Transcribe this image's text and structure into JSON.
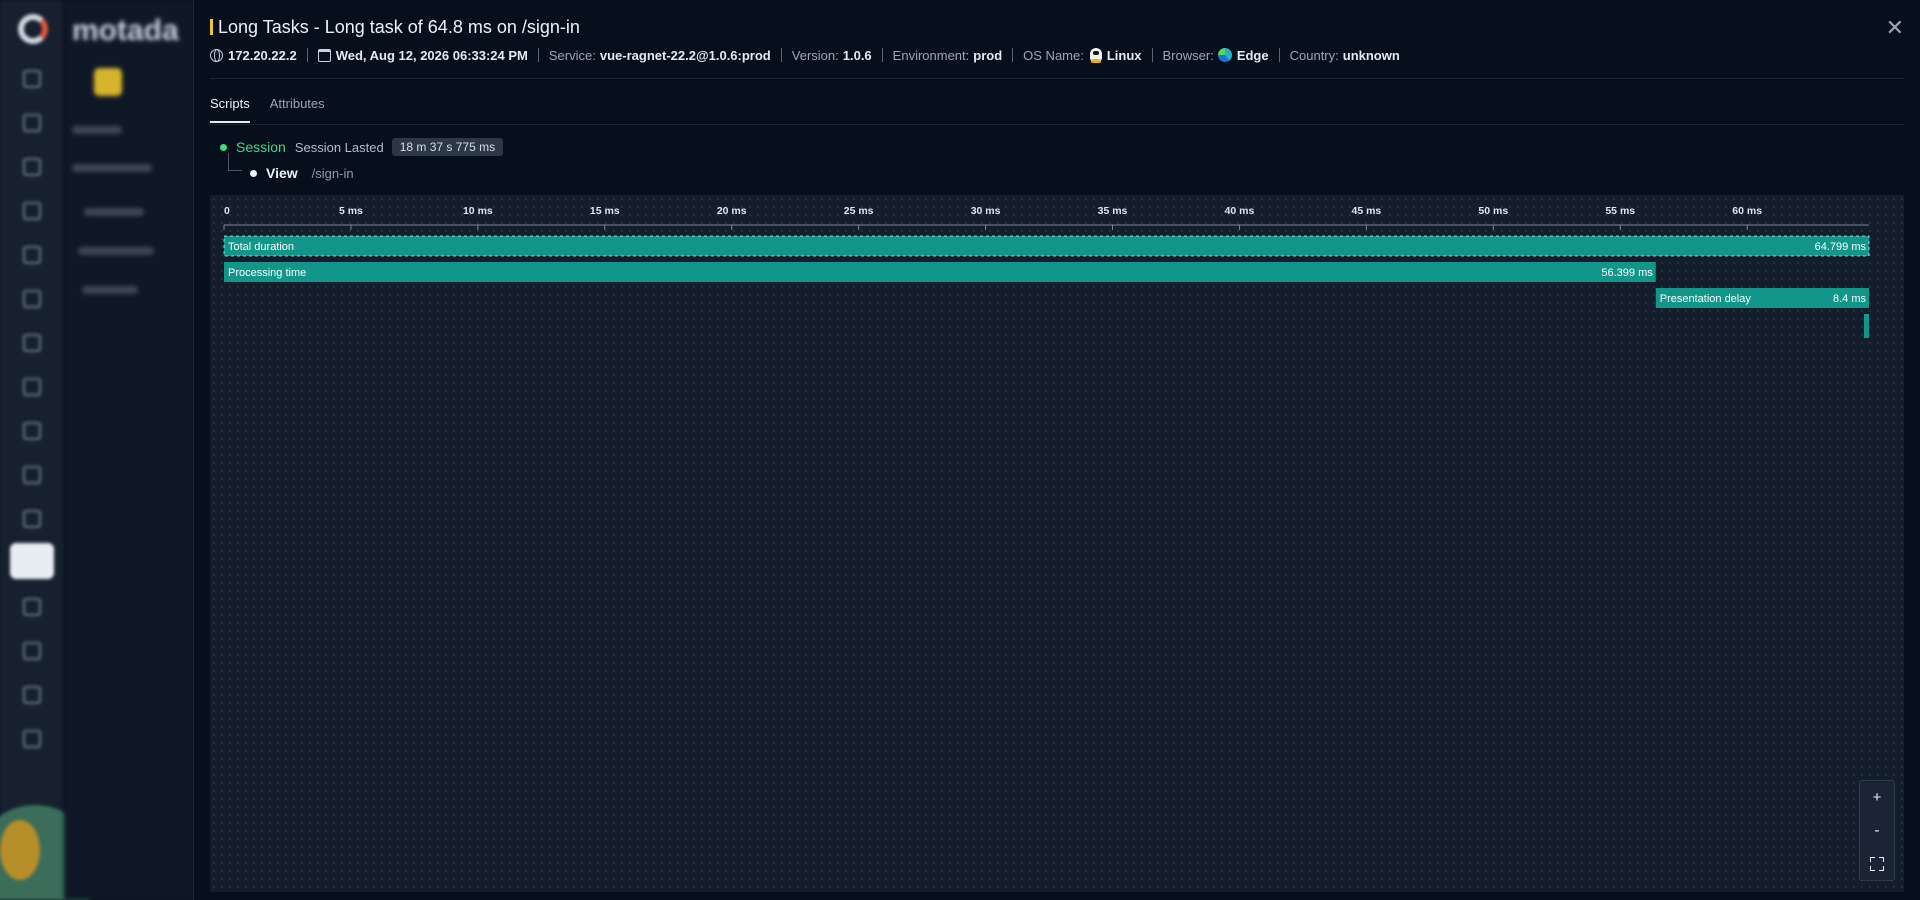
{
  "app": {
    "brand": "motada"
  },
  "header": {
    "title": "Long Tasks - Long task of 64.8 ms on /sign-in",
    "close_glyph": "✕",
    "meta": {
      "ip": "172.20.22.2",
      "datetime": "Wed, Aug 12, 2026 06:33:24 PM",
      "service_key": "Service:",
      "service_value": "vue-ragnet-22.2@1.0.6:prod",
      "version_key": "Version:",
      "version_value": "1.0.6",
      "environment_key": "Environment:",
      "environment_value": "prod",
      "os_key": "OS Name:",
      "os_value": "Linux",
      "browser_key": "Browser:",
      "browser_value": "Edge",
      "country_key": "Country:",
      "country_value": "unknown"
    }
  },
  "tabs": [
    {
      "label": "Scripts",
      "active": true
    },
    {
      "label": "Attributes",
      "active": false
    }
  ],
  "tree": {
    "session_label": "Session",
    "session_lasted_label": "Session Lasted",
    "session_duration": "18 m 37 s 775 ms",
    "view_label": "View",
    "view_path": "/sign-in"
  },
  "colors": {
    "accent": "#f2c230",
    "bar": "#12968a",
    "session": "#3ddc84"
  },
  "chart_data": {
    "type": "gantt",
    "x_unit": "ms",
    "xlim": [
      0,
      64.799
    ],
    "ticks": [
      {
        "value": 0,
        "label": "0"
      },
      {
        "value": 5,
        "label": "5 ms"
      },
      {
        "value": 10,
        "label": "10 ms"
      },
      {
        "value": 15,
        "label": "15 ms"
      },
      {
        "value": 20,
        "label": "20 ms"
      },
      {
        "value": 25,
        "label": "25 ms"
      },
      {
        "value": 30,
        "label": "30 ms"
      },
      {
        "value": 35,
        "label": "35 ms"
      },
      {
        "value": 40,
        "label": "40 ms"
      },
      {
        "value": 45,
        "label": "45 ms"
      },
      {
        "value": 50,
        "label": "50 ms"
      },
      {
        "value": 55,
        "label": "55 ms"
      },
      {
        "value": 60,
        "label": "60 ms"
      }
    ],
    "bars": [
      {
        "name": "total-duration-bar",
        "label": "Total duration",
        "start": 0,
        "end": 64.799,
        "value_label": "64.799 ms"
      },
      {
        "name": "processing-time-bar",
        "label": "Processing time",
        "start": 0,
        "end": 56.399,
        "value_label": "56.399 ms"
      },
      {
        "name": "presentation-delay-bar",
        "label": "Presentation delay",
        "start": 56.399,
        "end": 64.799,
        "value_label": "8.4 ms"
      },
      {
        "name": "marker-bar",
        "label": "",
        "start": 64.6,
        "end": 64.799,
        "value_label": ""
      }
    ]
  },
  "zoom": {
    "in": "+",
    "out": "-"
  }
}
